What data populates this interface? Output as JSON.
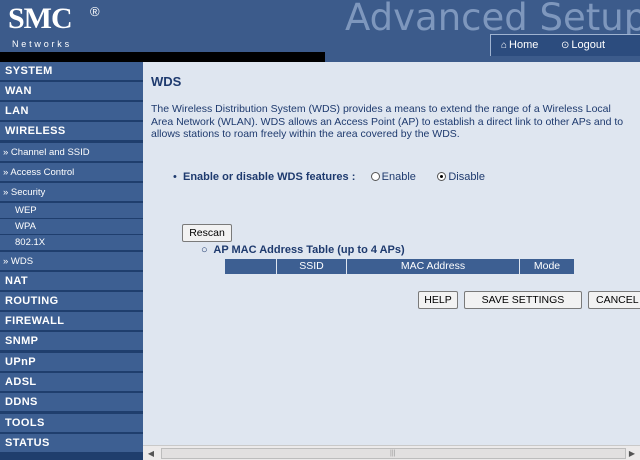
{
  "header": {
    "logo_text": "SMC",
    "logo_reg": "®",
    "logo_sub": "Networks",
    "big_title": "Advanced Setup",
    "home_label": "Home",
    "logout_label": "Logout",
    "home_icon": "home-icon",
    "logout_icon": "power-icon"
  },
  "sidebar": {
    "system": "SYSTEM",
    "wan": "WAN",
    "lan": "LAN",
    "wireless": "WIRELESS",
    "channel_ssid": "» Channel and SSID",
    "access_control": "» Access Control",
    "security": "» Security",
    "wep": "WEP",
    "wpa": "WPA",
    "dot1x": "802.1X",
    "wds": "» WDS",
    "nat": "NAT",
    "routing": "ROUTING",
    "firewall": "FIREWALL",
    "snmp": "SNMP",
    "upnp": "UPnP",
    "adsl": "ADSL",
    "ddns": "DDNS",
    "tools": "TOOLS",
    "status": "STATUS"
  },
  "main": {
    "title": "WDS",
    "description": "The Wireless Distribution System (WDS) provides a means to extend the range of a Wireless Local Area Network (WLAN). WDS allows an Access Point (AP) to establish a direct link to other APs and to allows stations to roam freely within the area covered by the WDS.",
    "wds_bullet": "•",
    "wds_label": "Enable or disable WDS features :",
    "enable_label": "Enable",
    "disable_label": "Disable",
    "selected": "Disable",
    "rescan_label": "Rescan",
    "table_bullet": "○",
    "table_title": "AP MAC Address Table (up to 4 APs)",
    "table_columns": [
      "",
      "SSID",
      "MAC Address",
      "Mode"
    ],
    "help_label": "HELP",
    "save_label": "SAVE SETTINGS",
    "cancel_label": "CANCEL"
  },
  "colors": {
    "header_bg": "#3c5b8b",
    "nav_item_bg": "#3d5f92",
    "content_bg": "#dfe6f0",
    "text": "#1e3a6e"
  }
}
